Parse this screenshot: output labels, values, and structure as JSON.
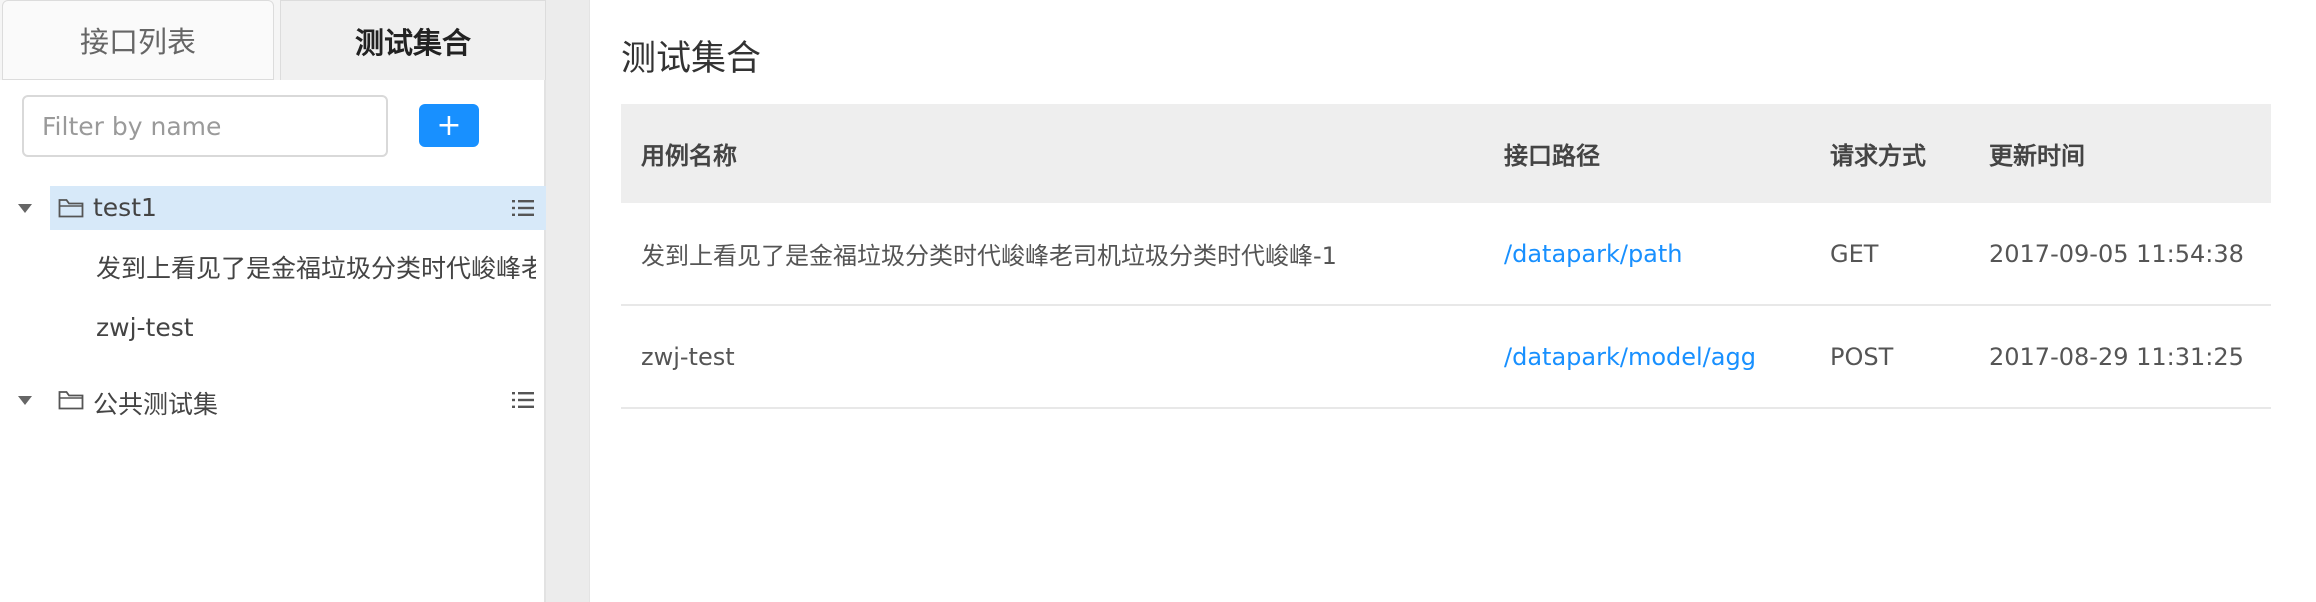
{
  "sidebar": {
    "tabs": [
      {
        "label": "接口列表",
        "active": false
      },
      {
        "label": "测试集合",
        "active": true
      }
    ],
    "filter_placeholder": "Filter by name",
    "add_label": "+",
    "tree": [
      {
        "label": "test1",
        "selected": true,
        "expanded": true,
        "children": [
          {
            "label": "发到上看见了是金福垃圾分类时代峻峰老司"
          },
          {
            "label": "zwj-test"
          }
        ]
      },
      {
        "label": "公共测试集",
        "selected": false,
        "expanded": true,
        "children": []
      }
    ]
  },
  "main": {
    "title": "测试集合",
    "table": {
      "headers": [
        "用例名称",
        "接口路径",
        "请求方式",
        "更新时间"
      ],
      "rows": [
        {
          "name": "发到上看见了是金福垃圾分类时代峻峰老司机垃圾分类时代峻峰-1",
          "path": "/datapark/path",
          "method": "GET",
          "updated": "2017-09-05 11:54:38"
        },
        {
          "name": "zwj-test",
          "path": "/datapark/model/agg",
          "method": "POST",
          "updated": "2017-08-29 11:31:25"
        }
      ]
    }
  },
  "colors": {
    "accent": "#1890ff",
    "selected_row": "#d7e9f9",
    "header_bg": "#eeeeee"
  }
}
